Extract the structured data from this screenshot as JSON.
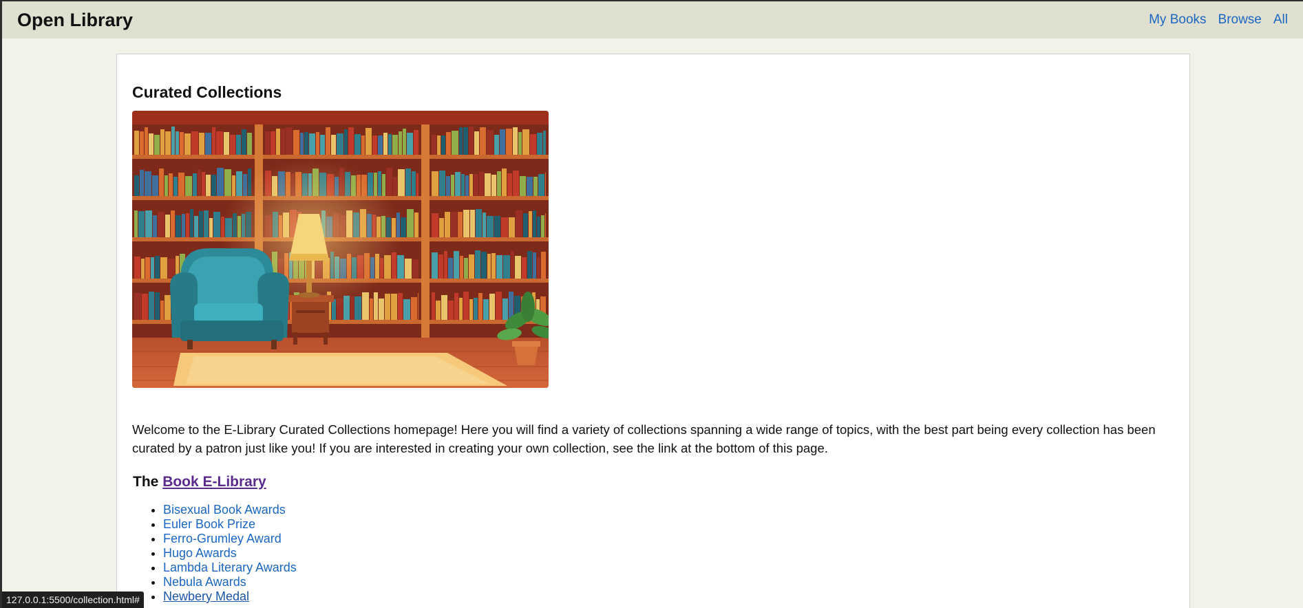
{
  "header": {
    "brand": "Open Library",
    "nav": [
      "My Books",
      "Browse",
      "All"
    ]
  },
  "main": {
    "title": "Curated Collections",
    "hero_image_alt": "illustrated library room with bookshelves, armchair and lamp",
    "intro": "Welcome to the E-Library Curated Collections homepage! Here you will find a variety of collections spanning a wide range of topics, with the best part being every collection has been curated by a patron just like you! If you are interested in creating your own collection, see the link at the bottom of this page.",
    "section": {
      "prefix": "The",
      "link_label": "Book E-Library"
    },
    "awards": [
      "Bisexual Book Awards",
      "Euler Book Prize",
      "Ferro-Grumley Award",
      "Hugo Awards",
      "Lambda Literary Awards",
      "Nebula Awards",
      "Newbery Medal"
    ]
  },
  "status_bar": {
    "url": "127.0.0.1:5500/collection.html#"
  },
  "colors": {
    "link": "#1a66c2",
    "visited_link": "#5a2a8c",
    "topbar_bg": "#e0e0d0",
    "page_bg": "#f2f2e8"
  }
}
